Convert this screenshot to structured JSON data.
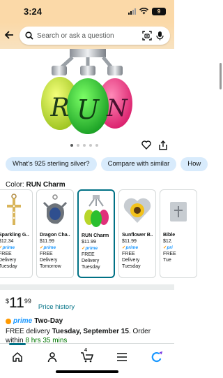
{
  "status_bar": {
    "time": "3:24",
    "battery": "9"
  },
  "search": {
    "placeholder": "Search or ask a question"
  },
  "product_image": {
    "charm_letters": [
      "R",
      "U",
      "N"
    ]
  },
  "carousel": {
    "total": 5,
    "active": 0
  },
  "chips": [
    "What's 925 sterling silver?",
    "Compare with similar",
    "How"
  ],
  "color": {
    "label": "Color:",
    "value": "RUN Charm"
  },
  "variants": [
    {
      "name": "Sparkling G...",
      "price": "$12.34",
      "prime": "prime",
      "delivery": "FREE Delivery",
      "day": "Tuesday",
      "selected": false
    },
    {
      "name": "Dragon Cha...",
      "price": "$11.99",
      "prime": "prime",
      "delivery": "FREE Delivery",
      "day": "Tomorrow",
      "selected": false
    },
    {
      "name": "RUN Charm",
      "price": "$11.99",
      "prime": "prime",
      "delivery": "FREE Delivery",
      "day": "Tuesday",
      "selected": true
    },
    {
      "name": "Sunflower B...",
      "price": "$11.99",
      "prime": "prime",
      "delivery": "FREE Delivery",
      "day": "Tuesday",
      "selected": false
    },
    {
      "name": "Bible",
      "price": "$12.",
      "prime": "pri",
      "delivery": "FREE",
      "day": "Tue",
      "selected": false
    }
  ],
  "price": {
    "currency": "$",
    "whole": "11",
    "fraction": "99",
    "history_label": "Price history"
  },
  "prime_delivery": {
    "prime_label": "prime",
    "title": "Two-Day"
  },
  "delivery": {
    "prefix": "FREE delivery ",
    "date": "Tuesday, September 15",
    "mid": ". Order within ",
    "countdown": "8 hrs 35 mins"
  },
  "tabs": {
    "cart_count": "4"
  },
  "colors": {
    "accent": "#007185",
    "header": "#fbd9a8",
    "chip": "#d8ebfc",
    "prime_blue": "#1a98ff",
    "delivery_green": "#007600"
  }
}
